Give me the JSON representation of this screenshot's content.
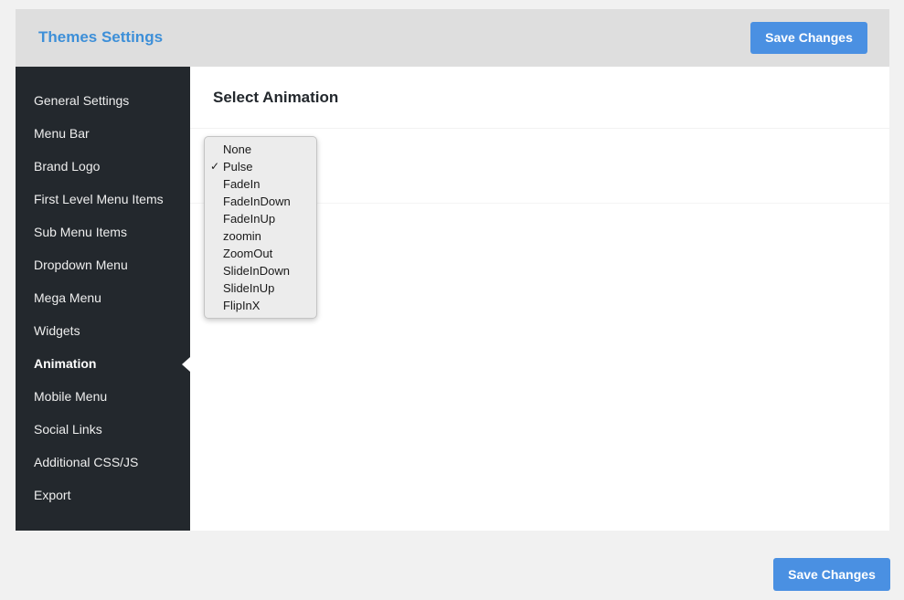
{
  "header": {
    "title": "Themes Settings",
    "save_label": "Save Changes"
  },
  "footer": {
    "save_label": "Save Changes"
  },
  "sidebar": {
    "items": [
      {
        "label": "General Settings"
      },
      {
        "label": "Menu Bar"
      },
      {
        "label": "Brand Logo"
      },
      {
        "label": "First Level Menu Items"
      },
      {
        "label": "Sub Menu Items"
      },
      {
        "label": "Dropdown Menu"
      },
      {
        "label": "Mega Menu"
      },
      {
        "label": "Widgets"
      },
      {
        "label": "Animation"
      },
      {
        "label": "Mobile Menu"
      },
      {
        "label": "Social Links"
      },
      {
        "label": "Additional CSS/JS"
      },
      {
        "label": "Export"
      }
    ],
    "active": "Animation"
  },
  "main": {
    "section_title": "Select Animation",
    "dropdown": {
      "selected": "Pulse",
      "check_glyph": "✓",
      "options": [
        {
          "label": "None"
        },
        {
          "label": "Pulse"
        },
        {
          "label": "FadeIn"
        },
        {
          "label": "FadeInDown"
        },
        {
          "label": "FadeInUp"
        },
        {
          "label": "zoomin"
        },
        {
          "label": "ZoomOut"
        },
        {
          "label": "SlideInDown"
        },
        {
          "label": "SlideInUp"
        },
        {
          "label": "FlipInX"
        }
      ]
    }
  },
  "colors": {
    "accent": "#4a90e2",
    "title_blue": "#3d8fd8",
    "sidebar_bg": "#23282d",
    "header_bg": "#dedede",
    "page_bg": "#f1f1f1"
  }
}
